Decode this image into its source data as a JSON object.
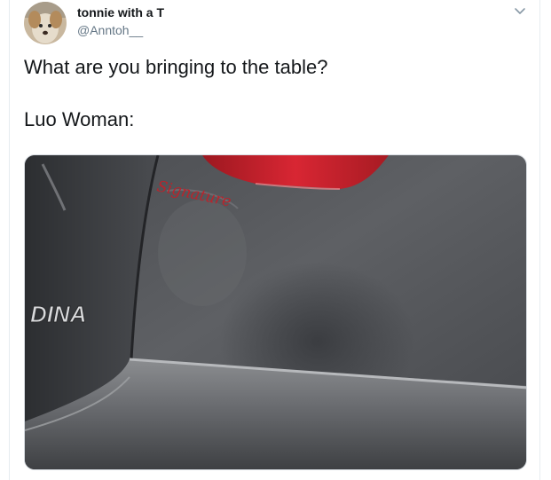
{
  "tweet": {
    "author_name": "tonnie with a T",
    "author_handle": "@Anntoh__",
    "text_lines": [
      "What are you bringing to the table?",
      "Luo Woman:"
    ],
    "avatar_icon": "dog-avatar",
    "menu_icon": "chevron-down-icon"
  },
  "media": {
    "badge_text": "DINA",
    "script_text": "Signature",
    "colors": {
      "car_body": "#56585c",
      "car_body_dark": "#2f3134",
      "taillight": "#c91f2a",
      "script_red": "#b8242c"
    }
  }
}
